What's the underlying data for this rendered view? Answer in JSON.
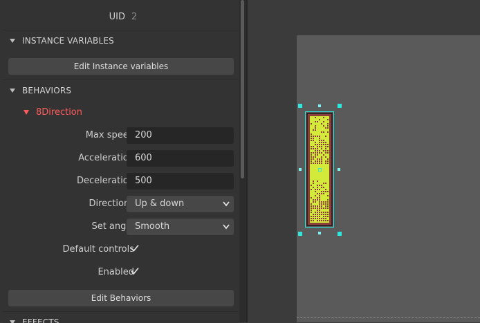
{
  "properties": {
    "uid_label": "UID",
    "uid_value": "2",
    "instance_variables": {
      "title": "INSTANCE VARIABLES",
      "edit_button": "Edit Instance variables"
    },
    "behaviors": {
      "title": "BEHAVIORS",
      "behavior_name": "8Direction",
      "max_speed_label": "Max speed",
      "max_speed_value": "200",
      "acceleration_label": "Acceleration",
      "acceleration_value": "600",
      "deceleration_label": "Deceleration",
      "deceleration_value": "500",
      "directions_label": "Directions",
      "directions_value": "Up & down",
      "set_angle_label": "Set angle",
      "set_angle_value": "Smooth",
      "default_controls_label": "Default controls",
      "default_controls_checked": true,
      "enabled_label": "Enabled",
      "enabled_checked": true,
      "edit_button": "Edit Behaviors"
    },
    "effects": {
      "title": "EFFECTS"
    }
  },
  "icons": {
    "collapse": "triangle-down-icon",
    "dropdown": "chevron-down-icon",
    "checkbox": "checkmark-icon"
  },
  "colors": {
    "accent_behavior": "#ff5c5c",
    "selection_handle": "#2ee8e0",
    "sprite_fill": "#d4ea3a",
    "sprite_frame": "#8b3f3a"
  }
}
